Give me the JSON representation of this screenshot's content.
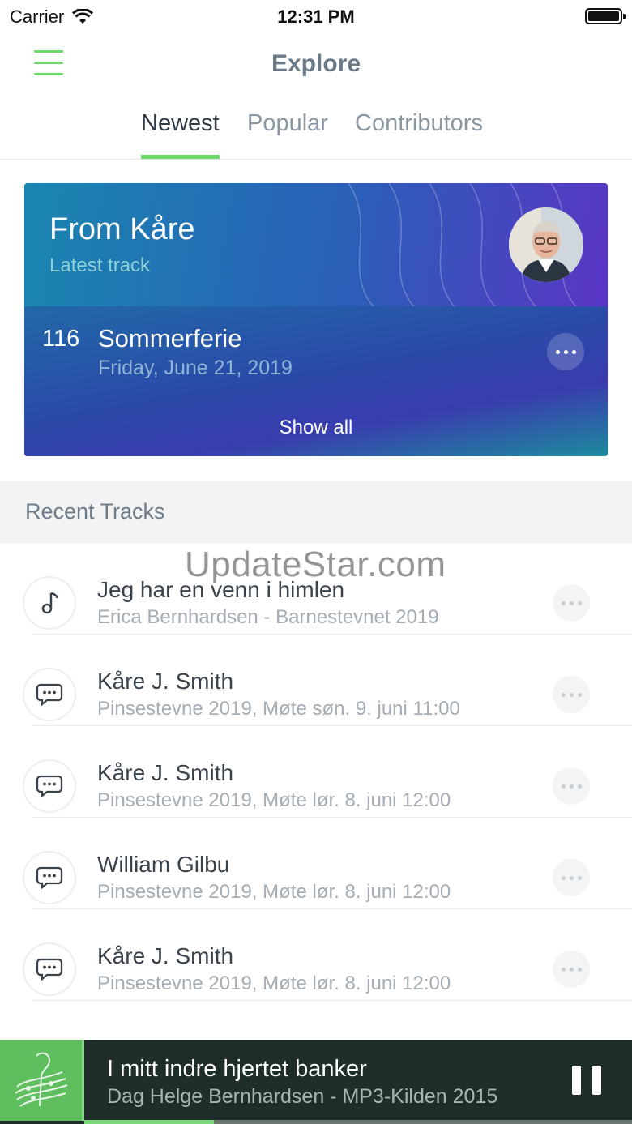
{
  "status_bar": {
    "carrier": "Carrier",
    "time": "12:31 PM"
  },
  "header": {
    "title": "Explore"
  },
  "tabs": [
    {
      "label": "Newest",
      "active": true
    },
    {
      "label": "Popular",
      "active": false
    },
    {
      "label": "Contributors",
      "active": false
    }
  ],
  "featured": {
    "title": "From Kåre",
    "subtitle": "Latest track",
    "track_number": "116",
    "track_name": "Sommerferie",
    "track_date": "Friday, June 21, 2019",
    "show_all_label": "Show all"
  },
  "recent": {
    "header": "Recent Tracks",
    "items": [
      {
        "icon": "music-note-icon",
        "title": "Jeg har en venn i himlen",
        "subtitle": "Erica Bernhardsen - Barnestevnet 2019"
      },
      {
        "icon": "speech-bubble-icon",
        "title": "Kåre J. Smith",
        "subtitle": "Pinsestevne 2019, Møte søn. 9. juni 11:00"
      },
      {
        "icon": "speech-bubble-icon",
        "title": "Kåre J. Smith",
        "subtitle": "Pinsestevne 2019, Møte lør. 8. juni 12:00"
      },
      {
        "icon": "speech-bubble-icon",
        "title": "William Gilbu",
        "subtitle": "Pinsestevne 2019, Møte lør. 8. juni 12:00"
      },
      {
        "icon": "speech-bubble-icon",
        "title": "Kåre J. Smith",
        "subtitle": "Pinsestevne 2019, Møte lør. 8. juni 12:00"
      }
    ]
  },
  "watermark": "UpdateStar.com",
  "player": {
    "title": "I mitt indre hjertet banker",
    "subtitle": "Dag Helge Bernhardsen - MP3-Kilden 2015",
    "progress": 0.237,
    "state": "playing"
  },
  "colors": {
    "accent": "#6bd96b",
    "title": "#6b7a88",
    "player_bg": "#1f2e2a"
  }
}
